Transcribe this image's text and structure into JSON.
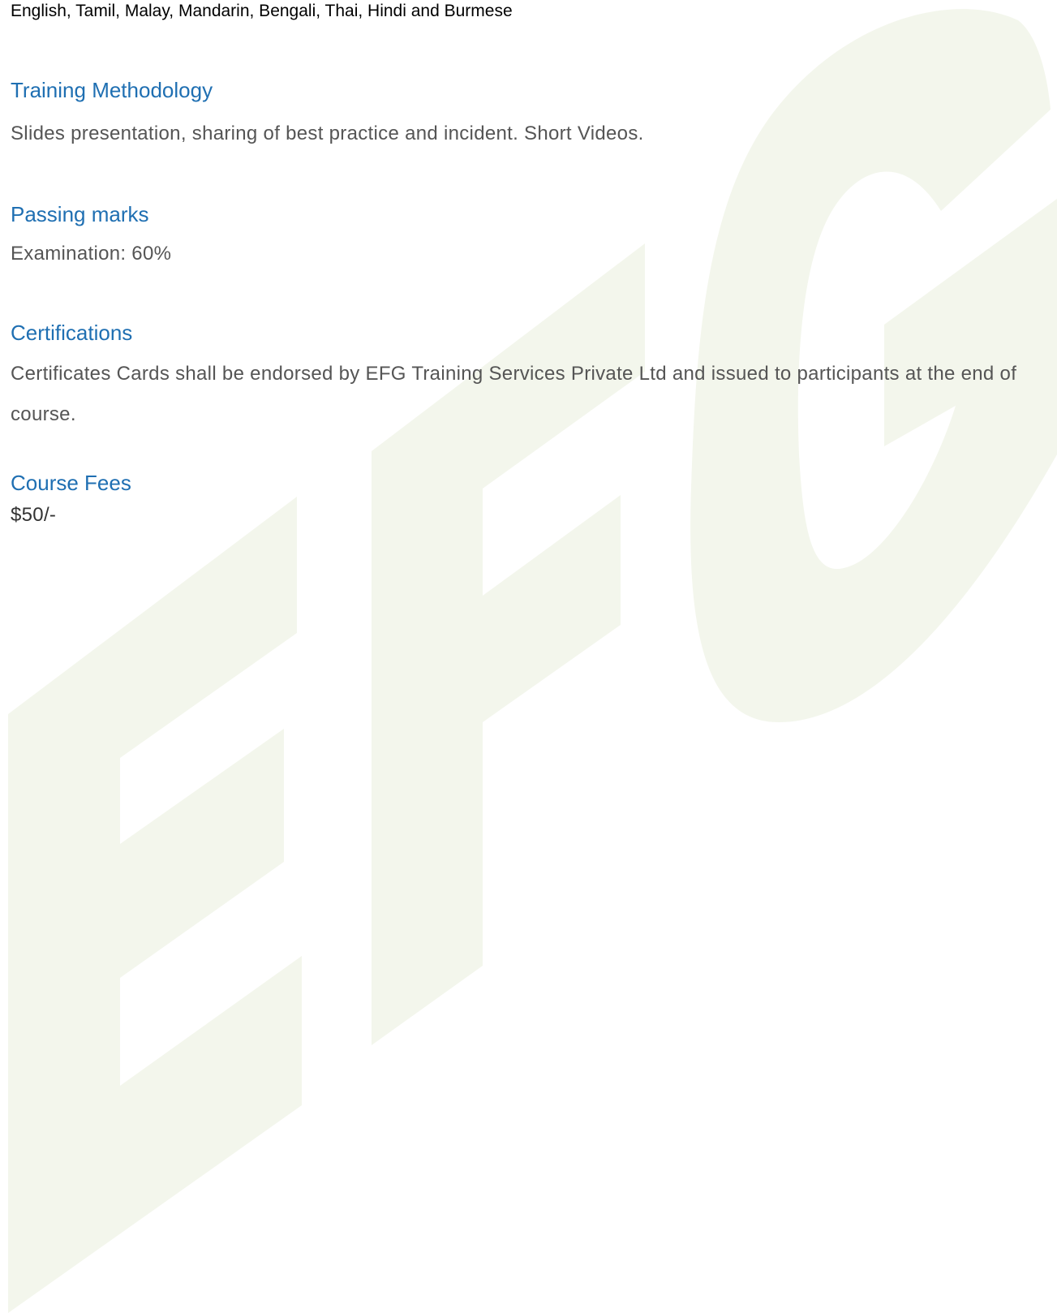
{
  "languages": "English, Tamil, Malay, Mandarin, Bengali, Thai, Hindi and Burmese",
  "sections": {
    "methodology": {
      "heading": "Training Methodology",
      "text": "Slides presentation, sharing of best practice and incident. Short Videos."
    },
    "passing": {
      "heading": "Passing marks",
      "text": "Examination: 60%"
    },
    "certifications": {
      "heading": "Certifications",
      "text": "Certificates Cards shall be endorsed by EFG Training Services Private Ltd and issued to participants at the end of course."
    },
    "fees": {
      "heading": "Course Fees",
      "text": "$50/-"
    }
  },
  "colors": {
    "heading": "#1f6fb2",
    "watermark": "#f3f6ec"
  },
  "watermark": {
    "text": "EFG"
  }
}
